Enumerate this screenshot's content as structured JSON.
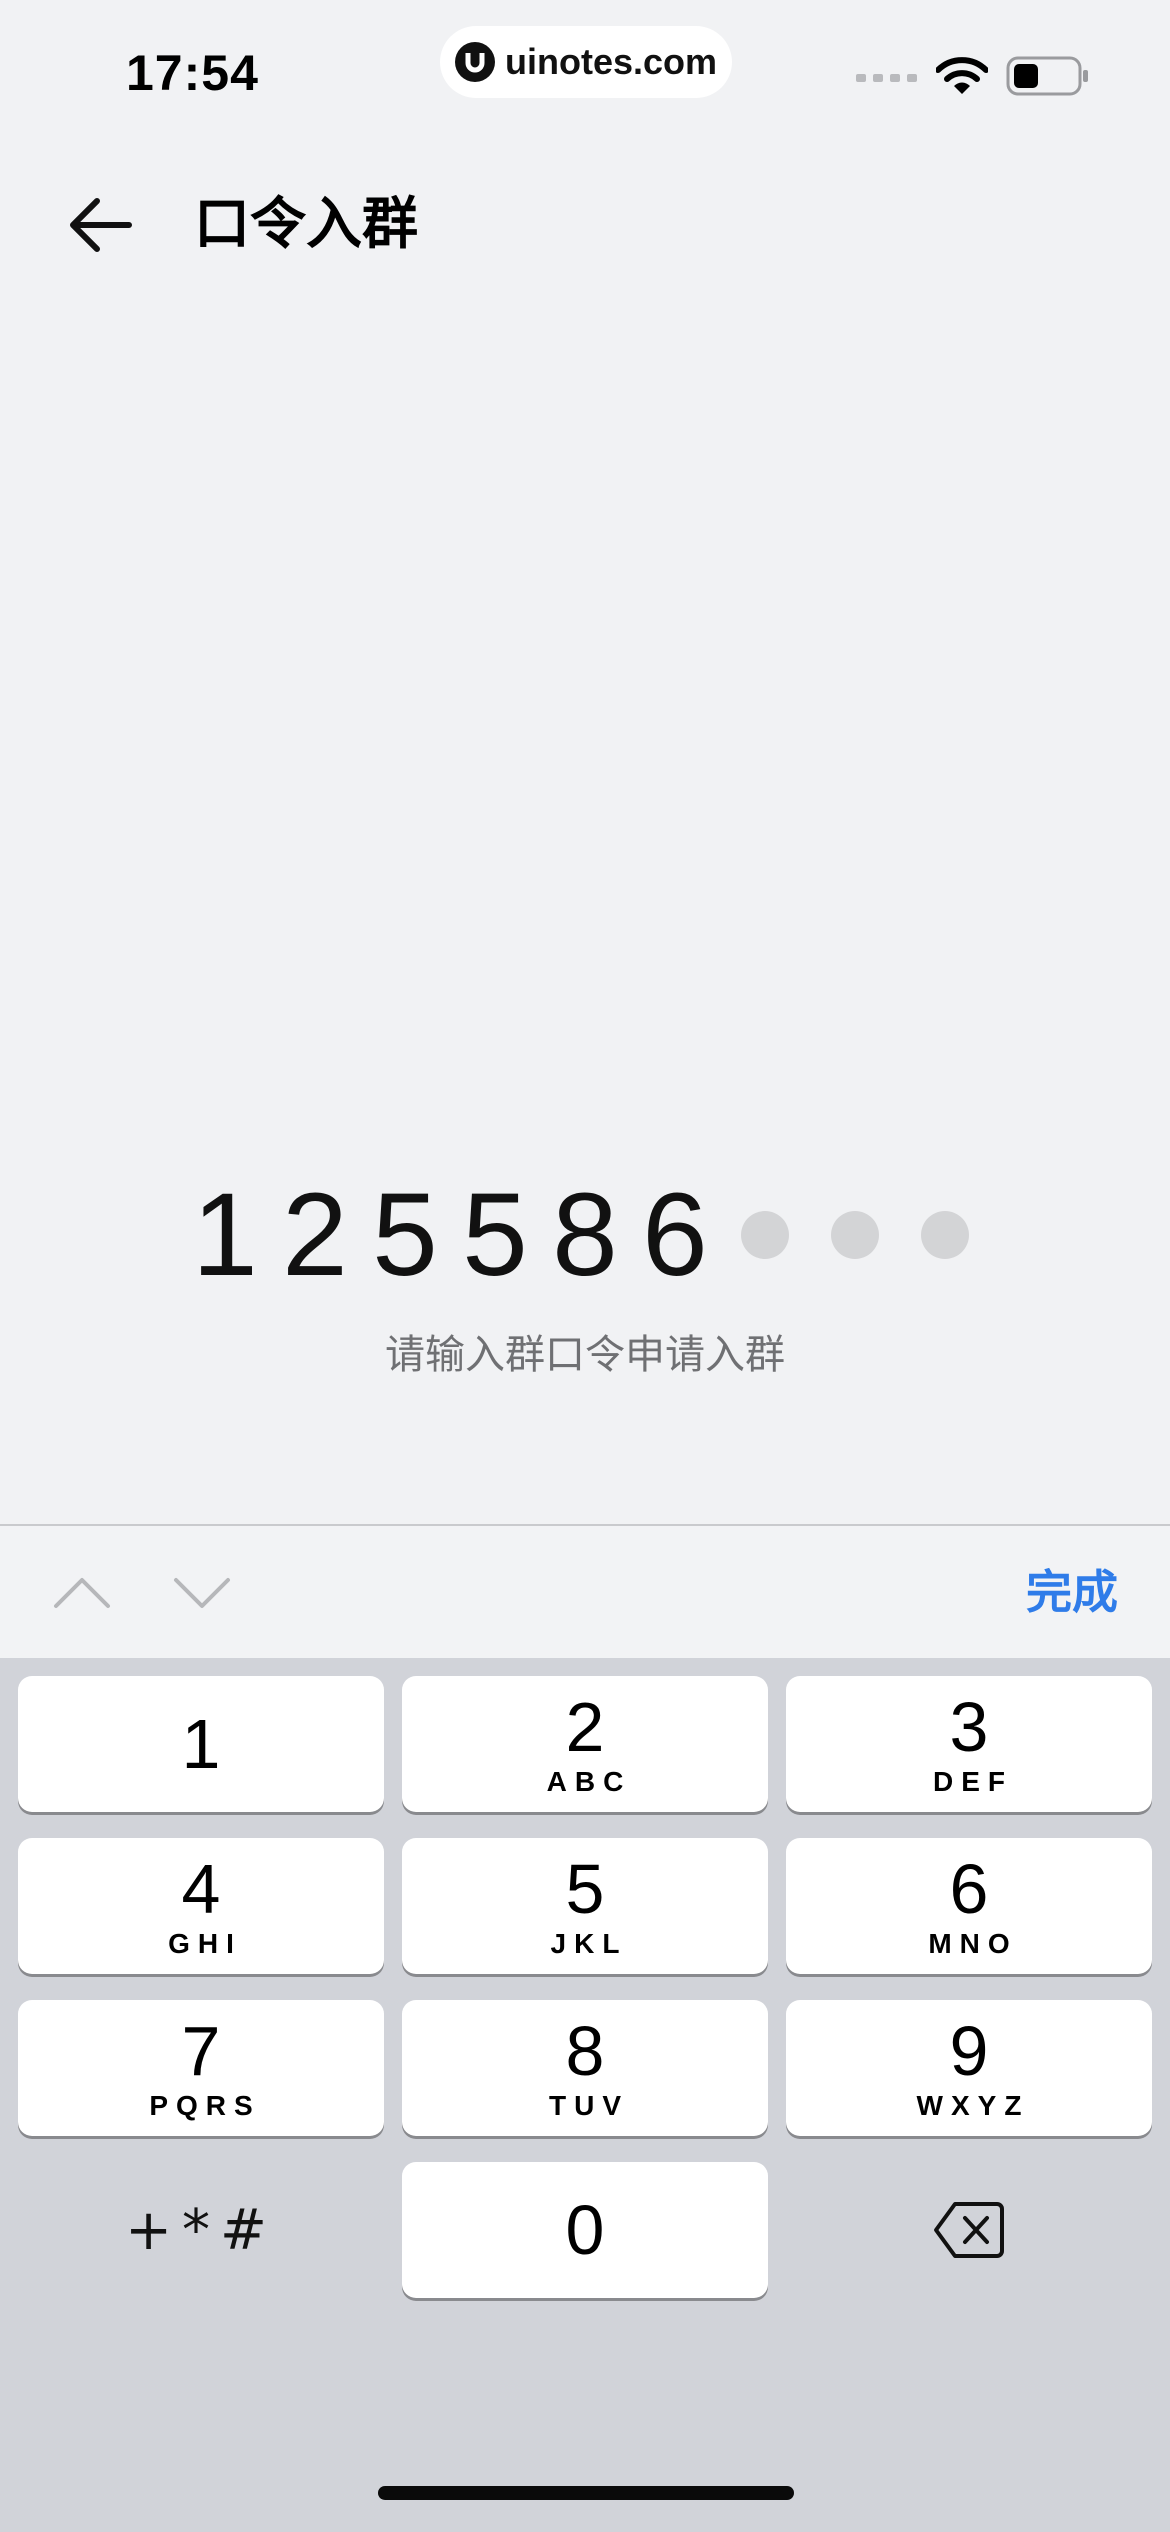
{
  "status_bar": {
    "time": "17:54",
    "url": "uinotes.com"
  },
  "nav": {
    "title": "口令入群"
  },
  "code": {
    "digits": [
      "1",
      "2",
      "5",
      "5",
      "8",
      "6"
    ],
    "empty_slots": 3,
    "hint": "请输入群口令申请入群"
  },
  "accessory": {
    "done_label": "完成"
  },
  "keypad": {
    "keys": [
      {
        "num": "1",
        "letters": ""
      },
      {
        "num": "2",
        "letters": "ABC"
      },
      {
        "num": "3",
        "letters": "DEF"
      },
      {
        "num": "4",
        "letters": "GHI"
      },
      {
        "num": "5",
        "letters": "JKL"
      },
      {
        "num": "6",
        "letters": "MNO"
      },
      {
        "num": "7",
        "letters": "PQRS"
      },
      {
        "num": "8",
        "letters": "TUV"
      },
      {
        "num": "9",
        "letters": "WXYZ"
      },
      {
        "num": "0",
        "letters": ""
      }
    ],
    "symbols_label": "+*#"
  },
  "colors": {
    "accent": "#2f7ce9",
    "background": "#f1f2f4",
    "keypad_background": "#d1d3d9"
  }
}
